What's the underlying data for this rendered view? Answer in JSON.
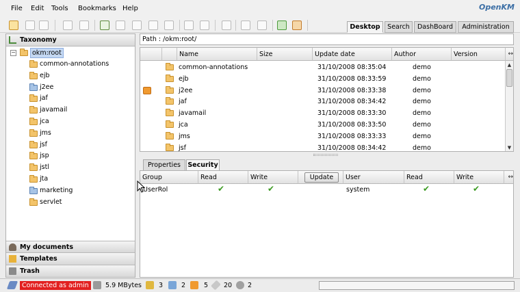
{
  "menu": [
    "File",
    "Edit",
    "Tools",
    "Bookmarks",
    "Help"
  ],
  "logo": "OpenKM",
  "view_tabs": [
    {
      "label": "Desktop",
      "active": true
    },
    {
      "label": "Search",
      "active": false
    },
    {
      "label": "DashBoard",
      "active": false
    },
    {
      "label": "Administration",
      "active": false
    }
  ],
  "left_panel": {
    "taxonomy_label": "Taxonomy",
    "root": "okm:root",
    "folders": [
      {
        "name": "common-annotations",
        "blue": false
      },
      {
        "name": "ejb",
        "blue": false
      },
      {
        "name": "j2ee",
        "blue": true
      },
      {
        "name": "jaf",
        "blue": false
      },
      {
        "name": "javamail",
        "blue": false
      },
      {
        "name": "jca",
        "blue": false
      },
      {
        "name": "jms",
        "blue": false
      },
      {
        "name": "jsf",
        "blue": false
      },
      {
        "name": "jsp",
        "blue": false
      },
      {
        "name": "jstl",
        "blue": false
      },
      {
        "name": "jta",
        "blue": false
      },
      {
        "name": "marketing",
        "blue": true
      },
      {
        "name": "servlet",
        "blue": false
      }
    ],
    "my_documents_label": "My documents",
    "templates_label": "Templates",
    "trash_label": "Trash"
  },
  "path": "Path : /okm:root/",
  "file_table": {
    "columns": [
      "Name",
      "Size",
      "Update date",
      "Author",
      "Version"
    ],
    "rows": [
      {
        "name": "common-annotations",
        "date": "31/10/2008 08:35:04",
        "author": "demo",
        "flag": false
      },
      {
        "name": "ejb",
        "date": "31/10/2008 08:33:59",
        "author": "demo",
        "flag": false
      },
      {
        "name": "j2ee",
        "date": "31/10/2008 08:33:38",
        "author": "demo",
        "flag": true
      },
      {
        "name": "jaf",
        "date": "31/10/2008 08:34:42",
        "author": "demo",
        "flag": false
      },
      {
        "name": "javamail",
        "date": "31/10/2008 08:33:30",
        "author": "demo",
        "flag": false
      },
      {
        "name": "jca",
        "date": "31/10/2008 08:33:50",
        "author": "demo",
        "flag": false
      },
      {
        "name": "jms",
        "date": "31/10/2008 08:33:33",
        "author": "demo",
        "flag": false
      },
      {
        "name": "jsf",
        "date": "31/10/2008 08:34:42",
        "author": "demo",
        "flag": false
      }
    ]
  },
  "prop_tabs": [
    {
      "label": "Properties",
      "active": false
    },
    {
      "label": "Security",
      "active": true
    }
  ],
  "security": {
    "group_headers": [
      "Group",
      "Read",
      "Write"
    ],
    "update_label": "Update",
    "user_headers": [
      "User",
      "Read",
      "Write"
    ],
    "group_row": {
      "name": "UserRol",
      "read": true,
      "write": true
    },
    "user_row": {
      "name": "system",
      "read": true,
      "write": true
    }
  },
  "status": {
    "connected": "Connected as admin",
    "size": "5.9 MBytes",
    "locked": "3",
    "checkout": "2",
    "subscribed": "5",
    "news": "20",
    "workflow": "2"
  },
  "colors": {
    "connected_bg": "#e22020",
    "check": "#3a9a20",
    "folder": "#f3c46a",
    "logo": "#3b6ea5"
  }
}
